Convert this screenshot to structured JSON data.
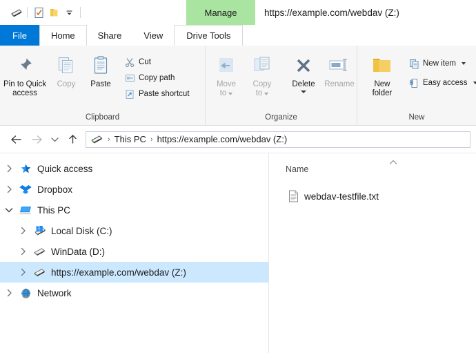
{
  "window": {
    "title": "https://example.com/webdav (Z:)",
    "contextual_tab_header": "Manage"
  },
  "quick_access_toolbar": {
    "items": [
      {
        "name": "drive-icon",
        "label": "Properties"
      },
      {
        "name": "properties-icon",
        "label": "Properties"
      },
      {
        "name": "new-folder-icon",
        "label": "New folder"
      },
      {
        "name": "customize-chevron-icon",
        "label": "Customize Quick Access Toolbar"
      }
    ]
  },
  "tabs": [
    {
      "id": "file",
      "label": "File"
    },
    {
      "id": "home",
      "label": "Home"
    },
    {
      "id": "share",
      "label": "Share"
    },
    {
      "id": "view",
      "label": "View"
    },
    {
      "id": "drive-tools",
      "label": "Drive Tools"
    }
  ],
  "ribbon": {
    "groups": [
      {
        "id": "clipboard",
        "label": "Clipboard",
        "big_buttons": [
          {
            "id": "pin-to-quick-access",
            "label": "Pin to Quick\naccess",
            "line1": "Pin to Quick",
            "line2": "access",
            "enabled": true
          },
          {
            "id": "copy",
            "label": "Copy",
            "line1": "Copy",
            "line2": "",
            "enabled": false
          },
          {
            "id": "paste",
            "label": "Paste",
            "line1": "Paste",
            "line2": "",
            "enabled": true
          }
        ],
        "small_buttons": [
          {
            "id": "cut",
            "label": "Cut",
            "enabled": true
          },
          {
            "id": "copy-path",
            "label": "Copy path",
            "enabled": true
          },
          {
            "id": "paste-shortcut",
            "label": "Paste shortcut",
            "enabled": true
          }
        ]
      },
      {
        "id": "organize",
        "label": "Organize",
        "big_buttons": [
          {
            "id": "move-to",
            "line1": "Move",
            "line2": "to",
            "enabled": false,
            "caret": "inline"
          },
          {
            "id": "copy-to",
            "line1": "Copy",
            "line2": "to",
            "enabled": false,
            "caret": "inline"
          },
          {
            "id": "delete",
            "line1": "Delete",
            "line2": "",
            "enabled": true,
            "caret": "under"
          },
          {
            "id": "rename",
            "line1": "Rename",
            "line2": "",
            "enabled": false,
            "caret": "none"
          }
        ]
      },
      {
        "id": "new",
        "label": "New",
        "big_buttons": [
          {
            "id": "new-folder",
            "line1": "New",
            "line2": "folder",
            "enabled": true
          }
        ],
        "small_buttons": [
          {
            "id": "new-item",
            "label": "New item",
            "enabled": true,
            "caret": true
          },
          {
            "id": "easy-access",
            "label": "Easy access",
            "enabled": true,
            "caret": true
          }
        ]
      }
    ]
  },
  "navigation": {
    "back_label": "Back",
    "forward_label": "Forward",
    "recent_label": "Recent locations",
    "up_label": "Up",
    "breadcrumbs": [
      {
        "id": "this-pc",
        "label": "This PC"
      },
      {
        "id": "webdav-drive",
        "label": "https://example.com/webdav (Z:)"
      }
    ],
    "separator": "›"
  },
  "sidebar": {
    "items": [
      {
        "id": "quick-access",
        "label": "Quick access",
        "icon": "star-icon",
        "indent": 0,
        "expanded": false,
        "selected": false
      },
      {
        "id": "dropbox",
        "label": "Dropbox",
        "icon": "dropbox-icon",
        "indent": 0,
        "expanded": false,
        "selected": false
      },
      {
        "id": "this-pc",
        "label": "This PC",
        "icon": "computer-icon",
        "indent": 0,
        "expanded": true,
        "selected": false
      },
      {
        "id": "local-disk-c",
        "label": "Local Disk (C:)",
        "icon": "windows-disk-icon",
        "indent": 1,
        "expanded": false,
        "selected": false
      },
      {
        "id": "windata-d",
        "label": "WinData (D:)",
        "icon": "disk-icon",
        "indent": 1,
        "expanded": false,
        "selected": false
      },
      {
        "id": "webdav-z",
        "label": "https://example.com/webdav (Z:)",
        "icon": "network-disk-icon",
        "indent": 1,
        "expanded": false,
        "selected": true
      },
      {
        "id": "network",
        "label": "Network",
        "icon": "network-icon",
        "indent": 0,
        "expanded": false,
        "selected": false
      }
    ]
  },
  "file_list": {
    "columns": [
      {
        "id": "name",
        "label": "Name",
        "sort": "ascending"
      }
    ],
    "rows": [
      {
        "id": "webdav-testfile",
        "name": "webdav-testfile.txt",
        "icon": "text-file-icon"
      }
    ]
  },
  "colors": {
    "file_tab_blue": "#0078d7",
    "contextual_green": "#a9e5a0",
    "selection_blue": "#cce8ff",
    "ribbon_bg": "#f6f6f6"
  }
}
